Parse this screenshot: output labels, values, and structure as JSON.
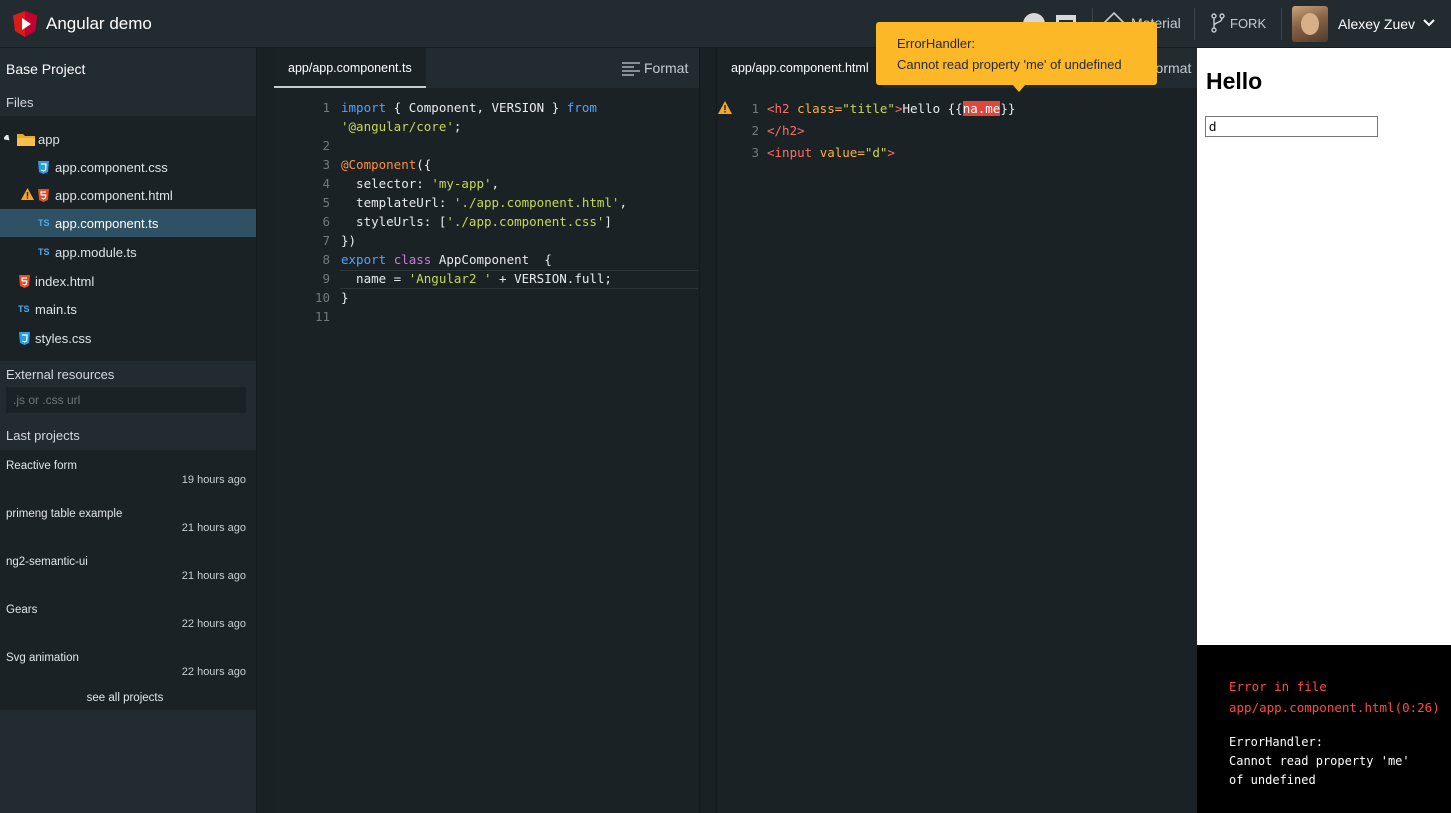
{
  "header": {
    "app_title": "Angular demo",
    "material_label": "Material",
    "fork_label": "FORK",
    "user_name": "Alexey Zuev"
  },
  "sidebar": {
    "project_title": "Base Project",
    "files_title": "Files",
    "tree": [
      {
        "label": "app",
        "icon": "folder-icon",
        "type": "folder"
      },
      {
        "label": "app.component.css",
        "icon": "css-file-icon",
        "type": "file"
      },
      {
        "label": "app.component.html",
        "icon": "html-file-icon",
        "type": "file",
        "warning": true
      },
      {
        "label": "app.component.ts",
        "icon": "ts-file-icon",
        "type": "file",
        "active": true
      },
      {
        "label": "app.module.ts",
        "icon": "ts-file-icon",
        "type": "file"
      },
      {
        "label": "index.html",
        "icon": "html-file-icon",
        "type": "file"
      },
      {
        "label": "main.ts",
        "icon": "ts-file-icon",
        "type": "file"
      },
      {
        "label": "styles.css",
        "icon": "css-file-icon",
        "type": "file"
      }
    ],
    "external_title": "External resources",
    "external_placeholder": ".js or .css url",
    "last_projects_title": "Last projects",
    "projects": [
      {
        "name": "Reactive form",
        "time": "19 hours ago"
      },
      {
        "name": "primeng table example",
        "time": "21 hours ago"
      },
      {
        "name": "ng2-semantic-ui",
        "time": "21 hours ago"
      },
      {
        "name": "Gears",
        "time": "22 hours ago"
      },
      {
        "name": "Svg animation",
        "time": "22 hours ago"
      }
    ],
    "see_all": "see all projects"
  },
  "editor_left": {
    "tab": "app/app.component.ts",
    "format_label": "Format"
  },
  "editor_right": {
    "tab": "app/app.component.html",
    "format_label": "Format"
  },
  "preview": {
    "heading": "Hello",
    "input_value": "d"
  },
  "error_panel": {
    "line1": "Error in file",
    "line2": "app/app.component.html(0:26)",
    "line3": "ErrorHandler:",
    "line4": "Cannot read property 'me'",
    "line5": "of undefined"
  },
  "tooltip": {
    "title": "ErrorHandler:",
    "message": "Cannot read property 'me' of undefined"
  },
  "colors": {
    "accent_orange": "#fcb827",
    "error_red": "#ff4b3e",
    "active_file_bg": "#2e5163"
  }
}
